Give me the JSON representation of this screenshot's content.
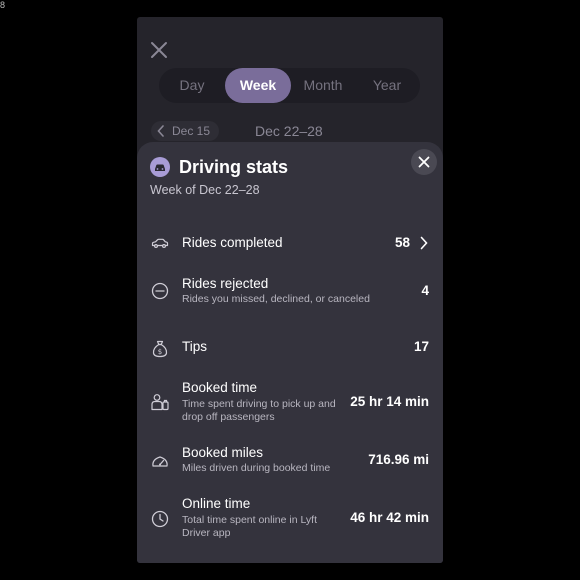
{
  "corner_glyph": "8",
  "header": {
    "tabs": [
      {
        "label": "Day"
      },
      {
        "label": "Week",
        "active": true
      },
      {
        "label": "Month"
      },
      {
        "label": "Year"
      }
    ],
    "prev_week_label": "Dec 15",
    "week_range": "Dec 22–28"
  },
  "sheet": {
    "title": "Driving stats",
    "subtitle": "Week of Dec 22–28",
    "rows": [
      {
        "title": "Rides completed",
        "description": "",
        "value": "58",
        "icon": "car-icon",
        "has_chevron": true
      },
      {
        "title": "Rides rejected",
        "description": "Rides you missed, declined, or canceled",
        "value": "4",
        "icon": "minus-circle-icon"
      },
      {
        "title": "Tips",
        "description": "",
        "value": "17",
        "icon": "money-bag-icon"
      },
      {
        "title": "Booked time",
        "description": "Time spent driving to pick up and drop off passengers",
        "value": "25 hr 14 min",
        "icon": "passenger-icon"
      },
      {
        "title": "Booked miles",
        "description": "Miles driven during booked time",
        "value": "716.96 mi",
        "icon": "speedometer-icon"
      },
      {
        "title": "Online time",
        "description": "Total time spent online in Lyft Driver app",
        "value": "46 hr 42 min",
        "icon": "clock-icon"
      }
    ]
  },
  "colors": {
    "accent": "#7a6d9a",
    "sheet_bg": "#34333d",
    "screen_bg": "#25242b"
  }
}
